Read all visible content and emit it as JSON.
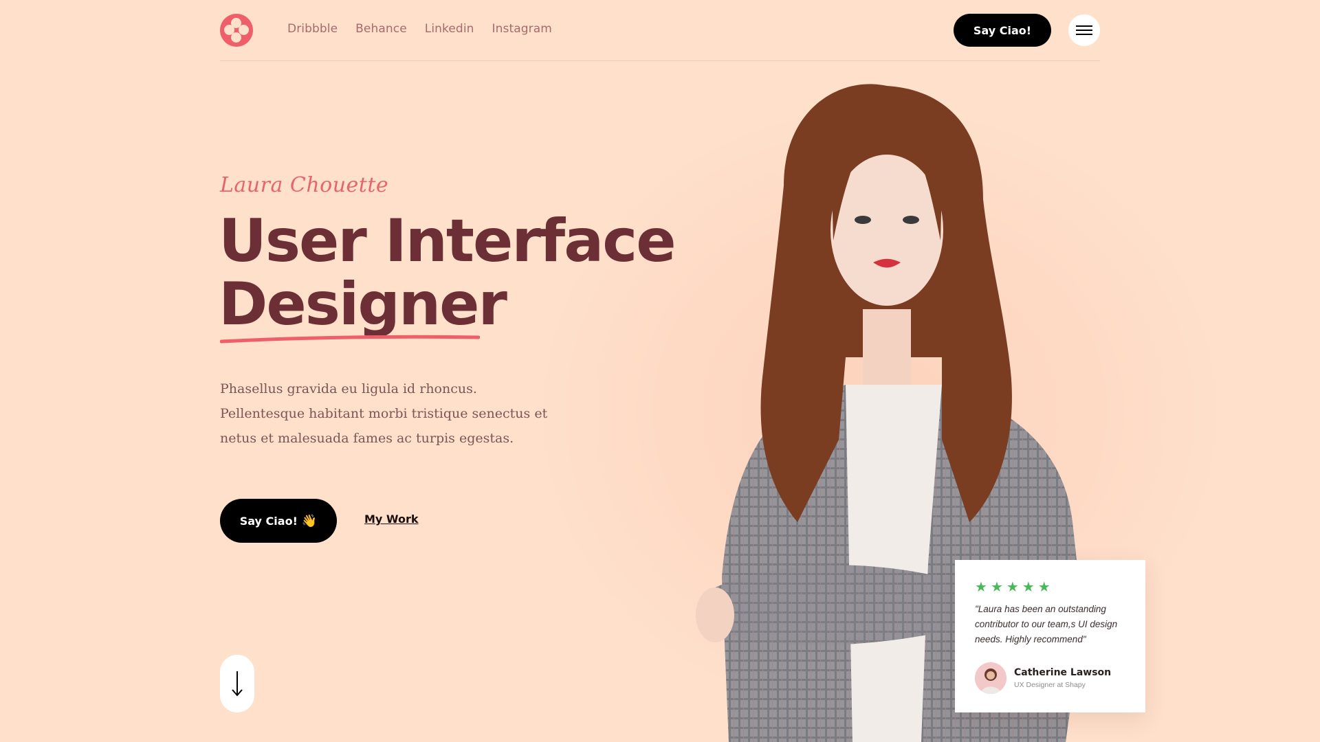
{
  "header": {
    "nav": [
      "Dribbble",
      "Behance",
      "Linkedin",
      "Instagram"
    ],
    "cta_label": "Say Ciao!"
  },
  "hero": {
    "eyebrow": "Laura Chouette",
    "title_line1": "User Interface",
    "title_line2": "Designer",
    "description": "Phasellus gravida eu ligula id rhoncus. Pellentesque habitant morbi tristique senectus et netus et malesuada fames ac turpis egestas.",
    "cta_label": "Say Ciao!",
    "cta_emoji": "👋",
    "secondary_link": "My Work"
  },
  "review": {
    "rating": 5,
    "quote": "\"Laura has been an outstanding contributor to our team,s UI design needs. Highly recommend\"",
    "name": "Catherine Lawson",
    "role": "UX Designer at Shapy"
  },
  "colors": {
    "background": "#fee0cb",
    "accent": "#ee5f6a",
    "title": "#6c2f36",
    "stars": "#49b85a"
  },
  "icons": {
    "logo": "flower-logo-icon",
    "menu": "hamburger-menu-icon",
    "scroll": "arrow-down-icon"
  }
}
